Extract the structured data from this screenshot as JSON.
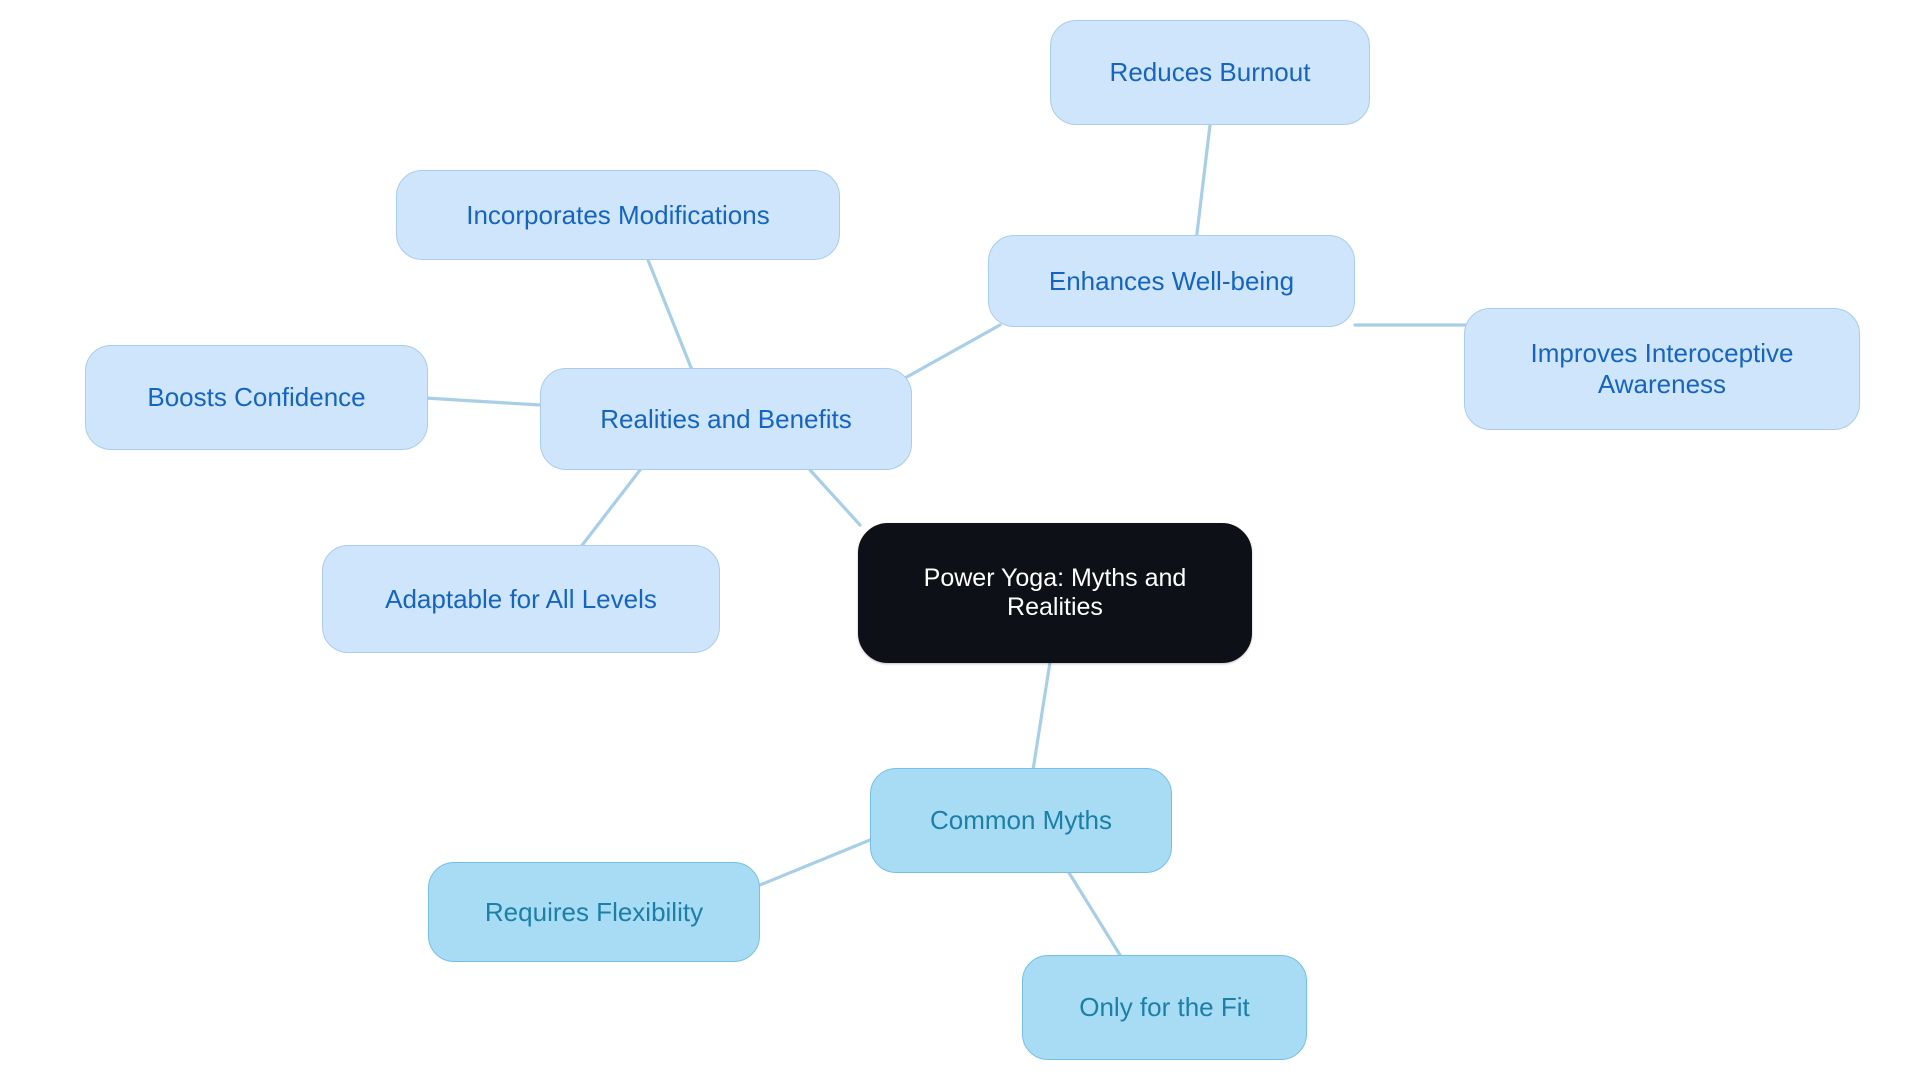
{
  "diagram": {
    "type": "mindmap",
    "title": "Power Yoga: Myths and Realities",
    "background_color": "#ffffff",
    "edge_color": "#a8cfe8",
    "palette": {
      "root_fill": "#0d1117",
      "root_text": "#ffffff",
      "light_fill": "#cfe5fb",
      "light_text": "#1565c0",
      "light_border": "#a9cdeb",
      "strong_fill": "#a8dcf5",
      "strong_text": "#1b7fa8",
      "strong_border": "#74c1e8"
    }
  },
  "nodes": {
    "root": {
      "label": "Power Yoga: Myths and\nRealities"
    },
    "realities": {
      "label": "Realities and Benefits"
    },
    "common_myths": {
      "label": "Common Myths"
    },
    "enhances_wellbeing": {
      "label": "Enhances Well-being"
    },
    "reduces_burnout": {
      "label": "Reduces Burnout"
    },
    "improves_interoception": {
      "label": "Improves Interoceptive\nAwareness"
    },
    "incorporates_modifications": {
      "label": "Incorporates Modifications"
    },
    "boosts_confidence": {
      "label": "Boosts Confidence"
    },
    "adaptable_all_levels": {
      "label": "Adaptable for All Levels"
    },
    "requires_flexibility": {
      "label": "Requires Flexibility"
    },
    "only_for_the_fit": {
      "label": "Only for the Fit"
    }
  },
  "edges": [
    {
      "from": "root",
      "to": "realities"
    },
    {
      "from": "root",
      "to": "common_myths"
    },
    {
      "from": "realities",
      "to": "enhances_wellbeing"
    },
    {
      "from": "realities",
      "to": "incorporates_modifications"
    },
    {
      "from": "realities",
      "to": "boosts_confidence"
    },
    {
      "from": "realities",
      "to": "adaptable_all_levels"
    },
    {
      "from": "enhances_wellbeing",
      "to": "reduces_burnout"
    },
    {
      "from": "enhances_wellbeing",
      "to": "improves_interoception"
    },
    {
      "from": "common_myths",
      "to": "requires_flexibility"
    },
    {
      "from": "common_myths",
      "to": "only_for_the_fit"
    }
  ]
}
